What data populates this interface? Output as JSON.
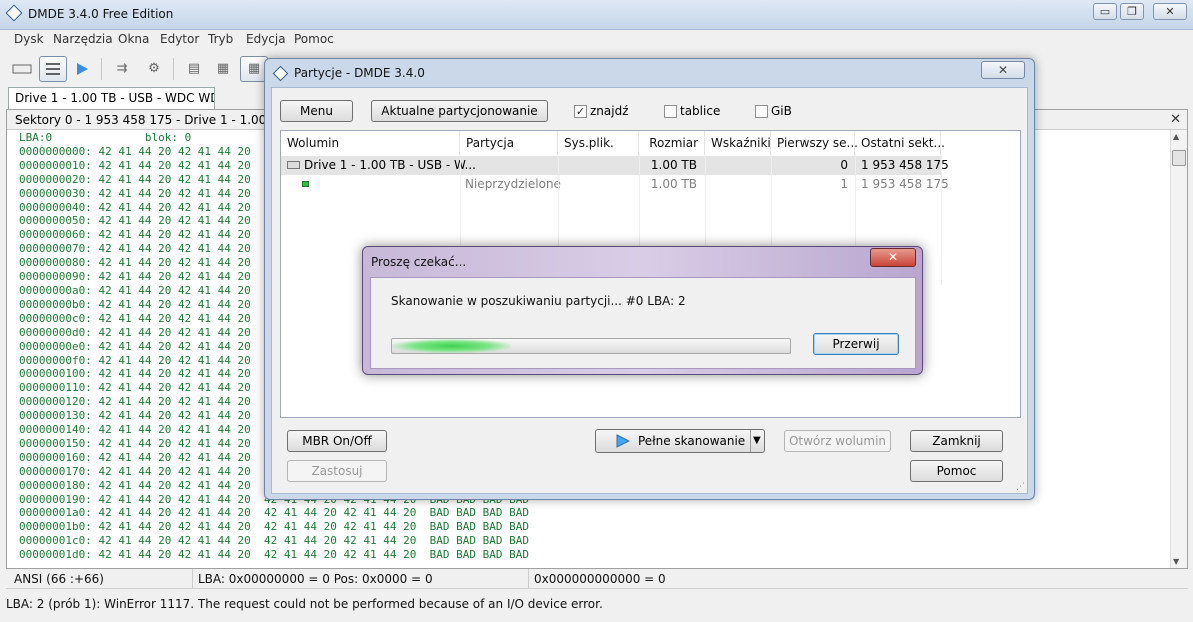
{
  "app": {
    "title": "DMDE 3.4.0 Free Edition",
    "caption_buttons": [
      "▭",
      "❐",
      "✕"
    ]
  },
  "menu": [
    "Dysk",
    "Narzędzia",
    "Okna",
    "Edytor",
    "Tryb",
    "Edycja",
    "Pomoc"
  ],
  "drive_tab": "Drive 1 - 1.00 TB - USB - WDC WD1...",
  "sector_panel": {
    "title": "Sektory 0 - 1 953 458 175 - Drive 1 - 1.00 TB - USB",
    "close": "✕",
    "header": "LBA:0              blok: 0",
    "offsets": [
      "0000000000:",
      "0000000010:",
      "0000000020:",
      "0000000030:",
      "0000000040:",
      "0000000050:",
      "0000000060:",
      "0000000070:",
      "0000000080:",
      "0000000090:",
      "00000000a0:",
      "00000000b0:",
      "00000000c0:",
      "00000000d0:",
      "00000000e0:",
      "00000000f0:",
      "0000000100:",
      "0000000110:",
      "0000000120:",
      "0000000130:",
      "0000000140:",
      "0000000150:",
      "0000000160:",
      "0000000170:",
      "0000000180:",
      "0000000190:",
      "00000001a0:",
      "00000001b0:",
      "00000001c0:",
      "00000001d0:"
    ],
    "bytes_left": "42 41 44 20 42 41 44 20",
    "bytes_right": "42 41 44 20 42 41 44 20",
    "ascii": "BAD BAD BAD BAD"
  },
  "status": {
    "encoding": "ANSI (66 :+66)",
    "lba": "LBA: 0x00000000 = 0  Pos: 0x0000 = 0",
    "value": "0x000000000000 = 0",
    "message": "LBA: 2 (prób 1): WinError 1117. The request could not be performed because of an I/O device error."
  },
  "partitions_dialog": {
    "title": "Partycje - DMDE 3.4.0",
    "close": "✕",
    "menu_button": "Menu",
    "current_button": "Aktualne partycjonowanie",
    "checks": [
      {
        "label": "znajdź",
        "checked": true
      },
      {
        "label": "tablice",
        "checked": false
      },
      {
        "label": "GiB",
        "checked": false
      }
    ],
    "columns": [
      "Wolumin",
      "Partycja",
      "Sys.plik.",
      "Rozmiar",
      "Wskaźniki",
      "Pierwszy se...",
      "Ostatni sekt..."
    ],
    "rows": [
      {
        "name": "Drive 1 - 1.00 TB - USB - W...",
        "partition": "",
        "fs": "",
        "size": "1.00 TB",
        "flags": "",
        "first": "0",
        "last": "1 953 458 175"
      },
      {
        "name": "",
        "partition": "Nieprzydzielone",
        "fs": "",
        "size": "1.00 TB",
        "flags": "",
        "first": "1",
        "last": "1 953 458 175"
      }
    ],
    "mbr_button": "MBR On/Off",
    "apply_button": "Zastosuj",
    "full_scan_button": "Pełne skanowanie",
    "open_volume_button": "Otwórz wolumin",
    "close_button": "Zamknij",
    "help_button": "Pomoc"
  },
  "progress_dialog": {
    "title": "Proszę czekać...",
    "close": "✕",
    "message": "Skanowanie w poszukiwaniu partycji...  #0  LBA: 2",
    "progress": 0.3,
    "cancel_button": "Przerwij"
  }
}
